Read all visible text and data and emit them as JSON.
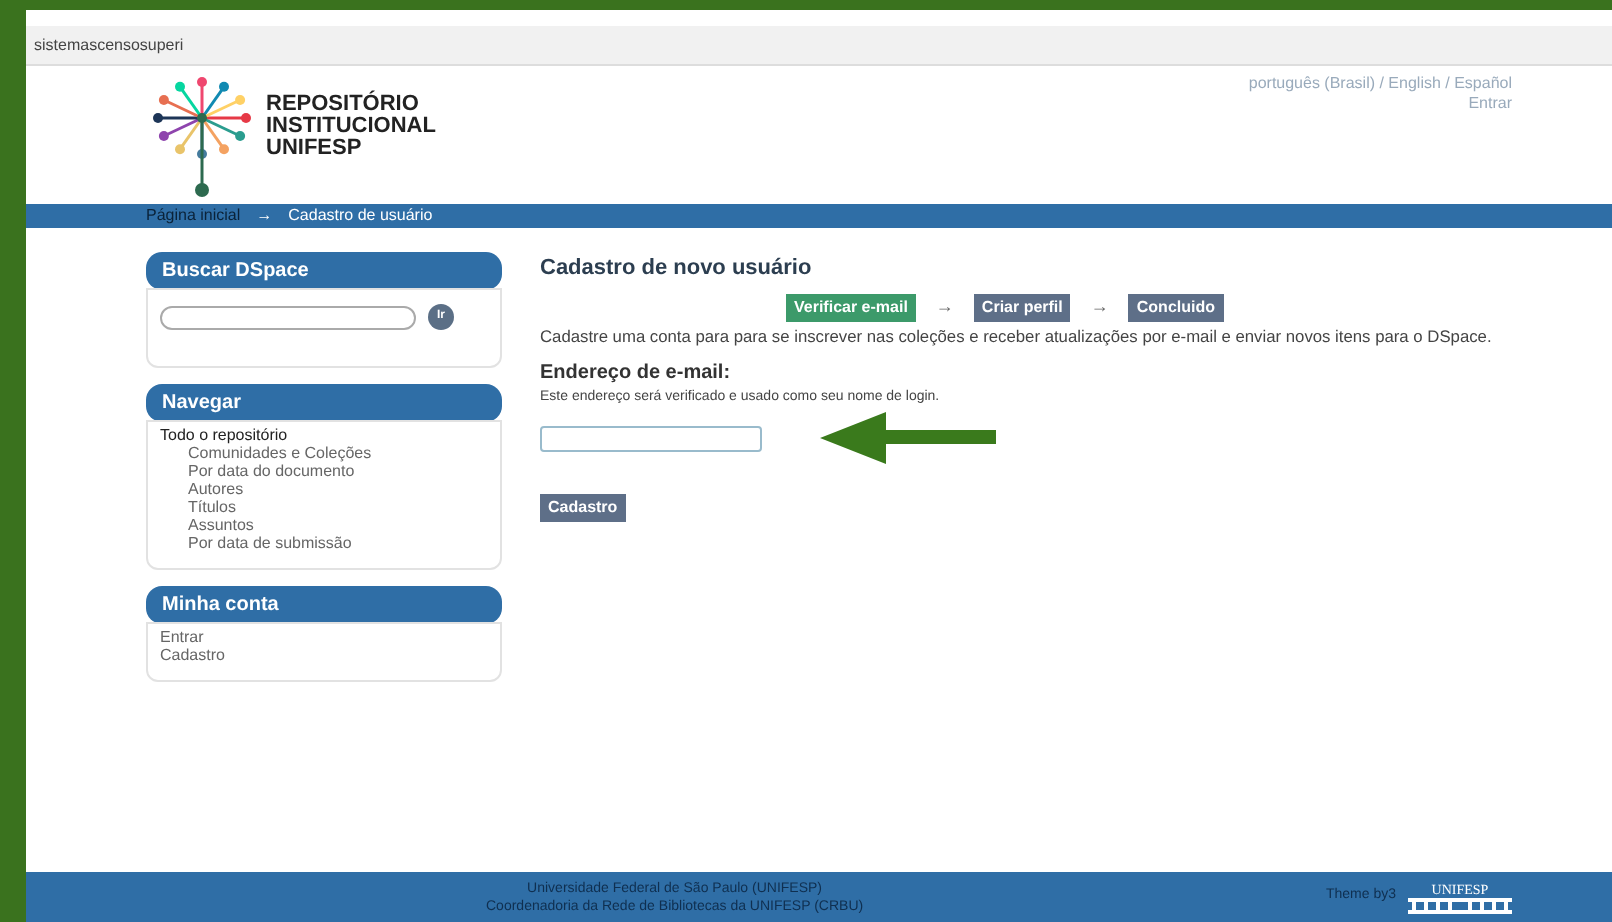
{
  "address_bar": {
    "url": "sistemascensosuperi"
  },
  "header": {
    "logo_lines": [
      "REPOSITÓRIO",
      "INSTITUCIONAL",
      "UNIFESP"
    ],
    "languages": "português (Brasil) / English / Español",
    "login": "Entrar"
  },
  "breadcrumb": [
    "Página inicial",
    "→",
    "Cadastro de usuário"
  ],
  "sidebar": [
    {
      "kind": "search",
      "title": "Buscar DSpace",
      "button": "Ir"
    },
    {
      "kind": "tree",
      "title": "Navegar",
      "items": [
        {
          "label": "Todo o repositório",
          "children": [
            {
              "label": "Comunidades e Coleções"
            },
            {
              "label": "Por data do documento"
            },
            {
              "label": "Autores"
            },
            {
              "label": "Títulos"
            },
            {
              "label": "Assuntos"
            },
            {
              "label": "Por data de submissão"
            }
          ]
        }
      ]
    },
    {
      "kind": "list",
      "title": "Minha conta",
      "items": [
        {
          "label": "Entrar"
        },
        {
          "label": "Cadastro"
        }
      ]
    }
  ],
  "main": {
    "title": "Cadastro de novo usuário",
    "steps": [
      {
        "label": "Verificar e-mail",
        "selected": true
      },
      {
        "label": "Criar perfil",
        "selected": false
      },
      {
        "label": "Concluido",
        "selected": false
      }
    ],
    "step_separator": "→",
    "intro": "Cadastre uma conta para para se inscrever nas coleções e receber atualizações por e-mail e enviar novos itens para o DSpace.",
    "field_label": "Endereço de e-mail:",
    "field_help": "Este endereço será verificado e usado como seu nome de login.",
    "submit": "Cadastro"
  },
  "footer": {
    "lines": [
      "Universidade Federal de São Paulo (UNIFESP)",
      "Coordenadoria da Rede de Bibliotecas da UNIFESP (CRBU)"
    ],
    "theme": "Theme by3",
    "logo": "UNIFESP"
  }
}
